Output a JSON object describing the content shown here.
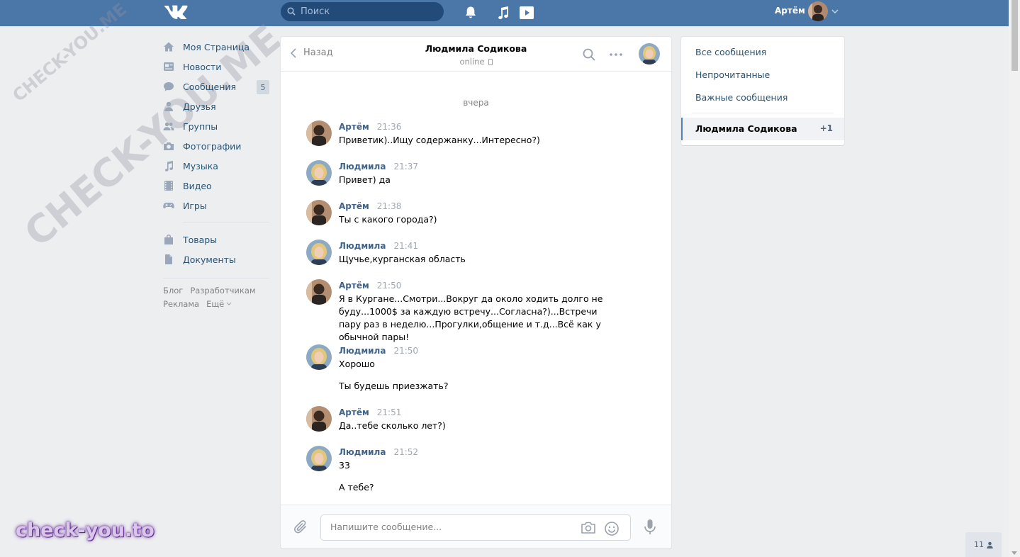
{
  "header": {
    "search_placeholder": "Поиск",
    "user_name": "Артём",
    "icons": [
      "vk-logo-icon",
      "search-icon",
      "bell-icon",
      "music-icon",
      "play-icon",
      "chevron-down-icon"
    ],
    "colors": {
      "bar": "#4a76a8",
      "search_bg": "#224b7a"
    }
  },
  "sidebar": {
    "items": [
      {
        "label": "Моя Страница",
        "icon": "home-icon"
      },
      {
        "label": "Новости",
        "icon": "news-icon"
      },
      {
        "label": "Сообщения",
        "icon": "messages-icon",
        "badge": "5"
      },
      {
        "label": "Друзья",
        "icon": "user-icon"
      },
      {
        "label": "Группы",
        "icon": "group-icon"
      },
      {
        "label": "Фотографии",
        "icon": "camera-icon"
      },
      {
        "label": "Музыка",
        "icon": "music-icon"
      },
      {
        "label": "Видео",
        "icon": "film-icon"
      },
      {
        "label": "Игры",
        "icon": "gamepad-icon"
      }
    ],
    "items2": [
      {
        "label": "Товары",
        "icon": "bag-icon"
      },
      {
        "label": "Документы",
        "icon": "document-icon"
      }
    ],
    "footer": [
      "Блог",
      "Разработчикам",
      "Реклама",
      "Ещё"
    ]
  },
  "chat": {
    "back_label": "Назад",
    "peer_name": "Людмила Содикова",
    "peer_status": "online",
    "day_label": "вчера",
    "messages": [
      {
        "author": "Артём",
        "time": "21:36",
        "text": "Приветик)..Ищу содержанку...Интересно?)"
      },
      {
        "author": "Людмила",
        "time": "21:37",
        "text": "Привет) да"
      },
      {
        "author": "Артём",
        "time": "21:38",
        "text": "Ты с какого города?)"
      },
      {
        "author": "Людмила",
        "time": "21:41",
        "text": "Щучье,курганская область"
      },
      {
        "author": "Артём",
        "time": "21:50",
        "text": "Я в Кургане...Смотри...Вокруг да около ходить долго не буду...1000$ за каждую встречу...Согласна?)...Встречи пару раз в неделю...Прогулки,общение и т.д...Всё как у обычной пары!"
      },
      {
        "author": "Людмила",
        "time": "21:50",
        "text": "Хорошо",
        "text2": "Ты будешь приезжать?"
      },
      {
        "author": "Артём",
        "time": "21:51",
        "text": "Да..тебе сколько лет?)"
      },
      {
        "author": "Людмила",
        "time": "21:52",
        "text": "33",
        "text2": "А тебе?"
      }
    ],
    "composer_placeholder": "Напишите сообщение..."
  },
  "right_panel": {
    "filters": [
      "Все сообщения",
      "Непрочитанные",
      "Важные сообщения"
    ],
    "active_dialog": {
      "name": "Людмила Содикова",
      "count": "+1"
    }
  },
  "online_counter": "11",
  "watermark": {
    "logo": "check-you.to",
    "diagonal": "CHECK-YOU.ME"
  }
}
